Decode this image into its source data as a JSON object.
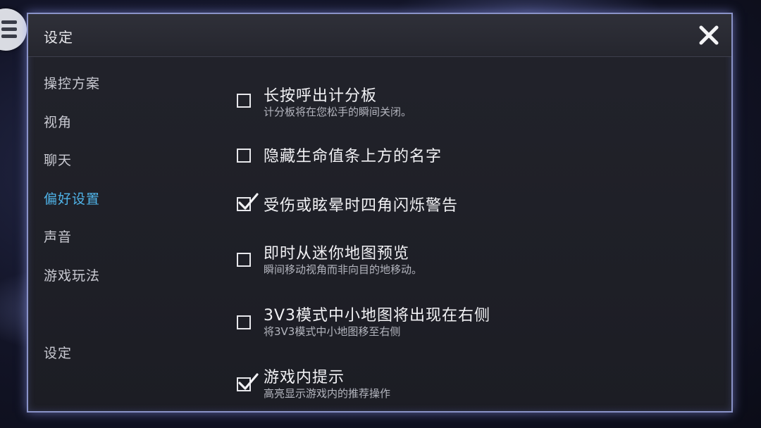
{
  "panel": {
    "title": "设定"
  },
  "sidebar": {
    "items": [
      {
        "label": "操控方案",
        "active": false
      },
      {
        "label": "视角",
        "active": false
      },
      {
        "label": "聊天",
        "active": false
      },
      {
        "label": "偏好设置",
        "active": true
      },
      {
        "label": "声音",
        "active": false
      },
      {
        "label": "游戏玩法",
        "active": false
      }
    ],
    "bottom_item": {
      "label": "设定"
    }
  },
  "options": [
    {
      "title": "长按呼出计分板",
      "description": "计分板将在您松手的瞬间关闭。",
      "checked": false
    },
    {
      "title": "隐藏生命值条上方的名字",
      "description": "",
      "checked": false
    },
    {
      "title": "受伤或眩晕时四角闪烁警告",
      "description": "",
      "checked": true
    },
    {
      "title": "即时从迷你地图预览",
      "description": "瞬间移动视角而非向目的地移动。",
      "checked": false
    },
    {
      "title": "3V3模式中小地图将出现在右侧",
      "description": "将3V3模式中小地图移至右侧",
      "checked": false
    },
    {
      "title": "游戏内提示",
      "description": "高亮显示游戏内的推荐操作",
      "checked": true
    }
  ],
  "icons": {
    "menu": "hamburger-menu-icon",
    "close": "close-icon",
    "check": "checkmark-icon"
  },
  "colors": {
    "accent": "#4fb3e8",
    "panel_border": "#8a93c8",
    "text": "#f2f2f5"
  }
}
